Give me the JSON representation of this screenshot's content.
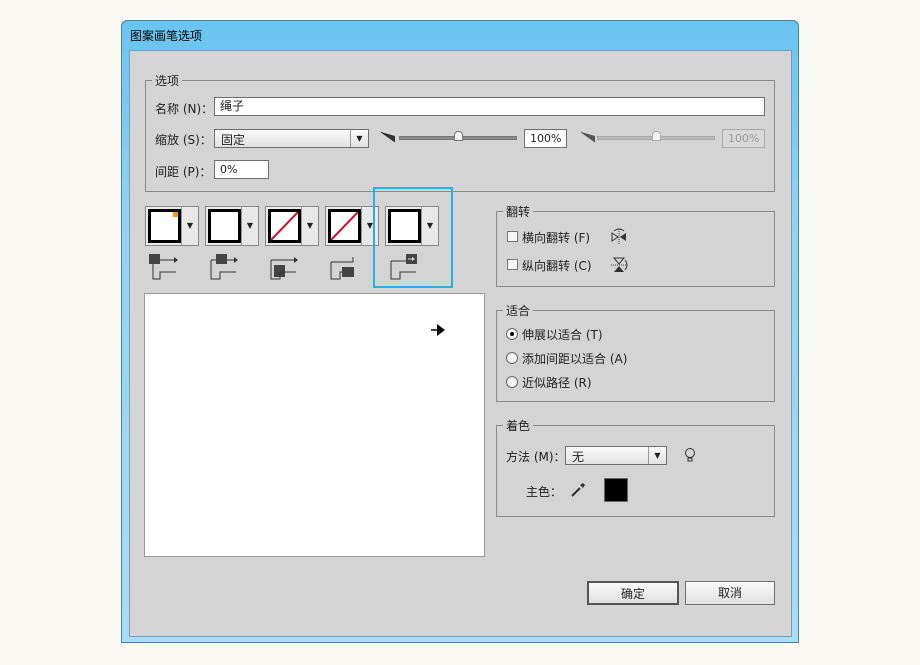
{
  "window": {
    "title": "图案画笔选项"
  },
  "options": {
    "legend": "选项",
    "name_label": "名称 (N)：",
    "name_value": "绳子",
    "scale_label": "缩放 (S)：",
    "scale_value": "固定",
    "scale_min": "100%",
    "scale_max": "100%",
    "scale_min_fraction": 0.5,
    "scale_max_fraction": 0.5,
    "spacing_label": "间距 (P)：",
    "spacing_value": "0%"
  },
  "tiles": [
    "side-tile",
    "outer-corner-tile",
    "inner-corner-tile",
    "start-tile",
    "end-tile"
  ],
  "flip": {
    "legend": "翻转",
    "horizontal": "横向翻转 (F)",
    "vertical": "纵向翻转 (C)",
    "horizontal_checked": false,
    "vertical_checked": false
  },
  "fit": {
    "legend": "适合",
    "options": [
      "伸展以适合 (T)",
      "添加间距以适合 (A)",
      "近似路径 (R)"
    ],
    "selected": 0
  },
  "colorize": {
    "legend": "着色",
    "method_label": "方法 (M)：",
    "method_value": "无",
    "key_color_label": "主色：",
    "key_color": "#000000"
  },
  "buttons": {
    "ok": "确定",
    "cancel": "取消"
  },
  "colors": {
    "highlight": "#1fb4e6",
    "corner_mark": "#f39c12",
    "none_slash": "#d0102a"
  }
}
